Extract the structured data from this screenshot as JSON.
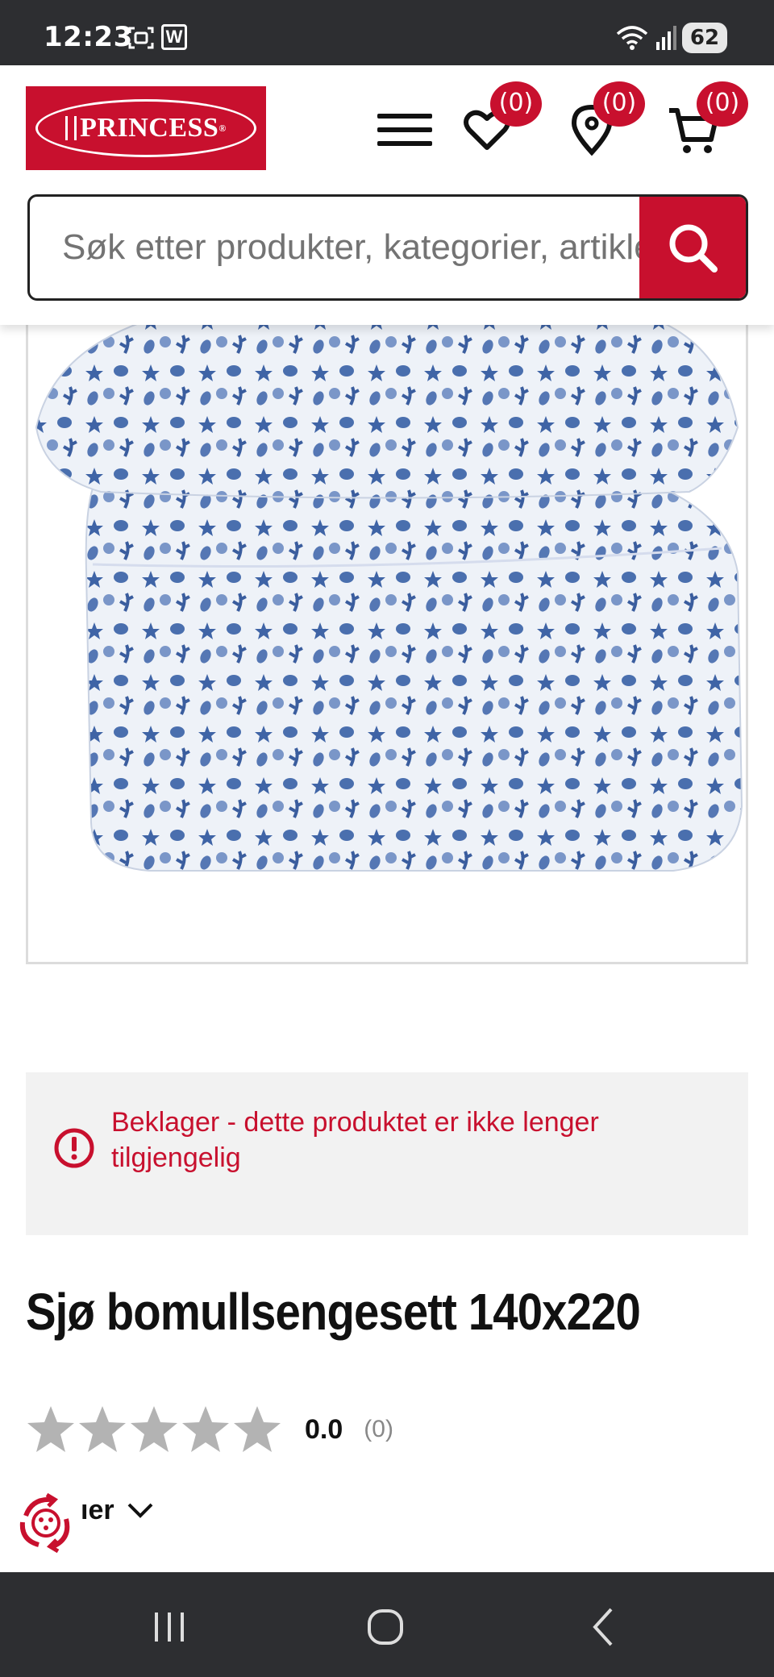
{
  "status_bar": {
    "time": "12:23",
    "app_icon_letter": "W",
    "battery": "62"
  },
  "header": {
    "logo_text": "PRINCESS",
    "wishlist_count": "(0)",
    "stores_count": "(0)",
    "cart_count": "(0)"
  },
  "search": {
    "placeholder": "Søk etter produkter, kategorier, artikler"
  },
  "notice": {
    "text": "Beklager - dette produktet er ikke lenger tilgjengelig"
  },
  "product": {
    "title": "Sjø bomullsengesett 140x220",
    "rating_value": "0.0",
    "rating_count": "(0)",
    "rating_stars": 0,
    "rating_max": 5
  },
  "more": {
    "label": "ıer"
  },
  "colors": {
    "brand_red": "#c8102e",
    "pattern_blue": "#3f64a6",
    "status_bar": "#2d2e31"
  },
  "icons": {
    "menu": "hamburger-icon",
    "wishlist": "heart-icon",
    "stores": "location-pin-icon",
    "cart": "cart-icon",
    "search": "search-icon",
    "notice": "alert-icon"
  }
}
